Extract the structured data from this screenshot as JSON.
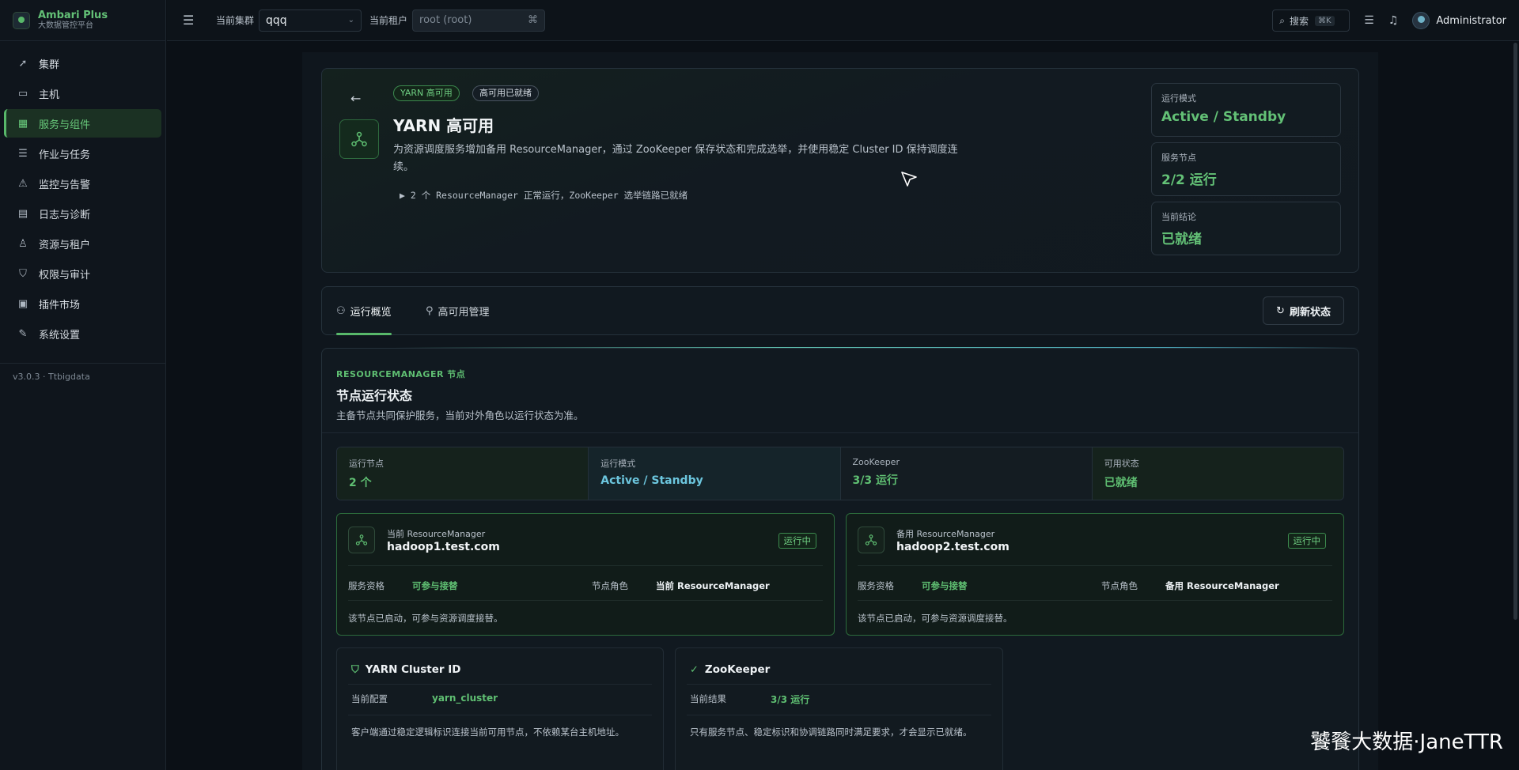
{
  "brand": {
    "title": "Ambari Plus",
    "subtitle": "大数据管控平台"
  },
  "sidebar": {
    "items": [
      {
        "label": "集群",
        "icon": "rocket-icon"
      },
      {
        "label": "主机",
        "icon": "monitor-icon"
      },
      {
        "label": "服务与组件",
        "icon": "grid-icon",
        "active": true
      },
      {
        "label": "作业与任务",
        "icon": "list-icon"
      },
      {
        "label": "监控与告警",
        "icon": "alarm-icon"
      },
      {
        "label": "日志与诊断",
        "icon": "log-icon"
      },
      {
        "label": "资源与租户",
        "icon": "users-icon"
      },
      {
        "label": "权限与审计",
        "icon": "shield-icon"
      },
      {
        "label": "插件市场",
        "icon": "plugin-icon"
      },
      {
        "label": "系统设置",
        "icon": "wrench-icon"
      }
    ],
    "version": "v3.0.3 · Ttbigdata"
  },
  "topbar": {
    "cluster_label": "当前集群",
    "cluster_value": "qqq",
    "tenant_label": "当前租户",
    "tenant_value": "root (root)",
    "search_label": "搜索",
    "search_shortcut": "⌘K",
    "user": "Administrator"
  },
  "hero": {
    "tag_primary": "YARN 高可用",
    "tag_secondary": "高可用已就绪",
    "title": "YARN 高可用",
    "description": "为资源调度服务增加备用 ResourceManager，通过 ZooKeeper 保存状态和完成选举，并使用稳定 Cluster ID 保持调度连续。",
    "detail": "▶ 2 个 ResourceManager 正常运行，ZooKeeper 选举链路已就绪",
    "stats": [
      {
        "label": "运行模式",
        "value": "Active / Standby"
      },
      {
        "label": "服务节点",
        "value": "2/2 运行"
      },
      {
        "label": "当前结论",
        "value": "已就绪"
      }
    ]
  },
  "tabs": {
    "overview": "运行概览",
    "ha_manage": "高可用管理",
    "refresh": "刷新状态"
  },
  "section": {
    "kicker": "RESOURCEMANAGER 节点",
    "title": "节点运行状态",
    "description": "主备节点共同保护服务，当前对外角色以运行状态为准。",
    "summary": [
      {
        "label": "运行节点",
        "value": "2 个"
      },
      {
        "label": "运行模式",
        "value": "Active / Standby"
      },
      {
        "label": "ZooKeeper",
        "value": "3/3 运行"
      },
      {
        "label": "可用状态",
        "value": "已就绪"
      }
    ],
    "nodes": [
      {
        "sub": "当前 ResourceManager",
        "host": "hadoop1.test.com",
        "badge": "运行中",
        "eligibility_label": "服务资格",
        "eligibility_value": "可参与接替",
        "role_label": "节点角色",
        "role_value": "当前 ResourceManager",
        "note": "该节点已启动，可参与资源调度接替。"
      },
      {
        "sub": "备用 ResourceManager",
        "host": "hadoop2.test.com",
        "badge": "运行中",
        "eligibility_label": "服务资格",
        "eligibility_value": "可参与接替",
        "role_label": "节点角色",
        "role_value": "备用 ResourceManager",
        "note": "该节点已启动，可参与资源调度接替。"
      }
    ],
    "info_cards": [
      {
        "title": "YARN Cluster ID",
        "icon": "shield-check-icon",
        "key": "当前配置",
        "value": "yarn_cluster",
        "note": "客户端通过稳定逻辑标识连接当前可用节点，不依赖某台主机地址。"
      },
      {
        "title": "ZooKeeper",
        "icon": "check-circle-icon",
        "key": "当前结果",
        "value": "3/3 运行",
        "note": "只有服务节点、稳定标识和协调链路同时满足要求，才会显示已就绪。"
      }
    ]
  },
  "watermark": "饕餮大数据·JaneTTR",
  "colors": {
    "accent": "#58b86a",
    "accent_text": "#63c176",
    "cyan": "#6cc6de",
    "bg": "#0b1016"
  }
}
